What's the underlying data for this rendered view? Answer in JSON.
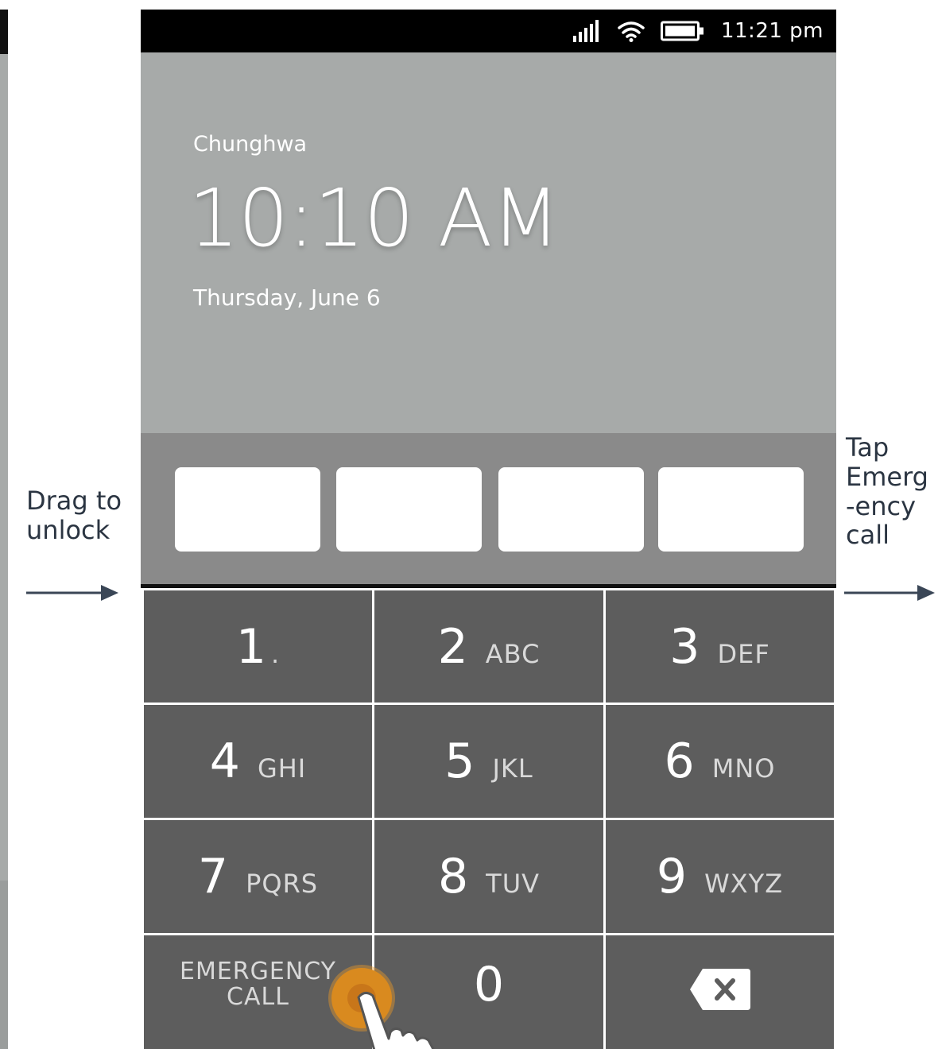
{
  "status_bar": {
    "time": "11:21 pm",
    "icons": [
      "signal-icon",
      "wifi-icon",
      "battery-icon"
    ]
  },
  "lockscreen": {
    "carrier": "Chunghwa",
    "clock": "10:10 AM",
    "date": "Thursday, June 6"
  },
  "passcode": {
    "box_count": 4
  },
  "keypad": {
    "keys": [
      {
        "num": "1",
        "letters": "."
      },
      {
        "num": "2",
        "letters": "ABC"
      },
      {
        "num": "3",
        "letters": "DEF"
      },
      {
        "num": "4",
        "letters": "GHI"
      },
      {
        "num": "5",
        "letters": "JKL"
      },
      {
        "num": "6",
        "letters": "MNO"
      },
      {
        "num": "7",
        "letters": "PQRS"
      },
      {
        "num": "8",
        "letters": "TUV"
      },
      {
        "num": "9",
        "letters": "WXYZ"
      }
    ],
    "emergency_line1": "EMERGENCY",
    "emergency_line2": "CALL",
    "zero": "0",
    "backspace_icon": "backspace-icon"
  },
  "annotations": {
    "left_line1": "Drag to",
    "left_line2": "unlock",
    "right_line1": "Tap",
    "right_line2": "Emerg",
    "right_line3": "-ency",
    "right_line4": "call"
  },
  "colors": {
    "lock_bg": "#a7aaa9",
    "passcode_bg": "#8a8a8a",
    "key_bg": "#5d5d5d",
    "touch_accent": "#d98a1f",
    "annotation_text": "#2b3542"
  }
}
